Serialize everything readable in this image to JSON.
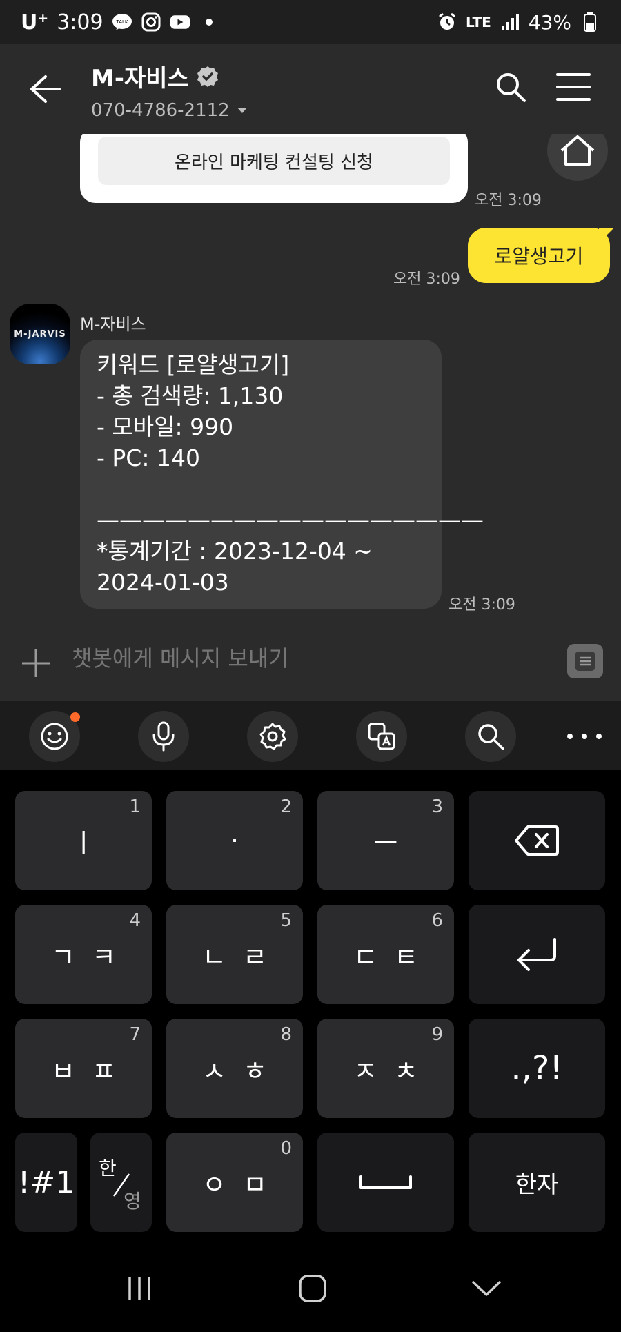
{
  "status_bar": {
    "carrier": "U⁺",
    "time": "3:09",
    "talk_badge": "TALK",
    "network": "LTE",
    "battery": "43%"
  },
  "header": {
    "title": "M-자비스",
    "phone": "070-4786-2112"
  },
  "chat": {
    "card_button": "온라인 마케팅 컨설팅 신청",
    "card_time": "오전 3:09",
    "my_message": "로얄생고기",
    "my_time": "오전 3:09",
    "avatar_text": "M-JARVIS",
    "sender": "M-자비스",
    "bot_message": "키워드 [로얄생고기]\n- 총 검색량: 1,130\n- 모바일: 990\n- PC: 140\n\n—————————————————\n*통계기간 : 2023-12-04 ~\n2024-01-03",
    "bot_time": "오전 3:09"
  },
  "input": {
    "placeholder": "챗봇에게 메시지 보내기"
  },
  "keyboard": {
    "row1": [
      {
        "label": "ㅣ",
        "num": "1"
      },
      {
        "label": "·",
        "num": "2"
      },
      {
        "label": "ㅡ",
        "num": "3"
      }
    ],
    "row2": [
      {
        "label": "ㄱㅋ",
        "num": "4"
      },
      {
        "label": "ㄴㄹ",
        "num": "5"
      },
      {
        "label": "ㄷㅌ",
        "num": "6"
      }
    ],
    "row3": [
      {
        "label": "ㅂㅍ",
        "num": "7"
      },
      {
        "label": "ㅅㅎ",
        "num": "8"
      },
      {
        "label": "ㅈㅊ",
        "num": "9"
      }
    ],
    "punct": ".,?!",
    "symbols": "!#1",
    "lang_top": "한",
    "lang_bottom": "영",
    "row4_key": {
      "label": "ㅇㅁ",
      "num": "0"
    },
    "hanja": "한자"
  },
  "colors": {
    "my_bubble": "#fde332",
    "chat_bg": "#2b2b2b",
    "bot_bubble": "#3e3e3e",
    "notification_dot": "#ff6a2a"
  }
}
